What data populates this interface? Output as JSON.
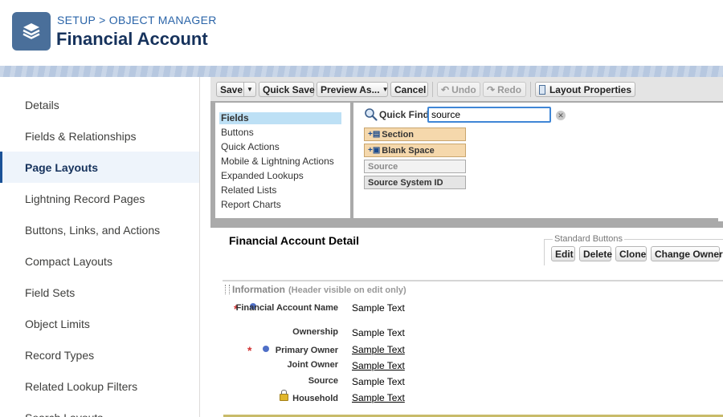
{
  "header": {
    "breadcrumb": "SETUP > OBJECT MANAGER",
    "title": "Financial Account",
    "icon": "layers-icon"
  },
  "nav": {
    "items": [
      {
        "label": "Details"
      },
      {
        "label": "Fields & Relationships"
      },
      {
        "label": "Page Layouts",
        "active": true
      },
      {
        "label": "Lightning Record Pages"
      },
      {
        "label": "Buttons, Links, and Actions"
      },
      {
        "label": "Compact Layouts"
      },
      {
        "label": "Field Sets"
      },
      {
        "label": "Object Limits"
      },
      {
        "label": "Record Types"
      },
      {
        "label": "Related Lookup Filters"
      },
      {
        "label": "Search Layouts"
      }
    ]
  },
  "toolbar": {
    "save": "Save",
    "quick_save": "Quick Save",
    "preview_as": "Preview As...",
    "cancel": "Cancel",
    "undo": "Undo",
    "redo": "Redo",
    "layout_properties": "Layout Properties"
  },
  "palette": {
    "categories": [
      {
        "label": "Fields",
        "active": true
      },
      {
        "label": "Buttons"
      },
      {
        "label": "Quick Actions"
      },
      {
        "label": "Mobile & Lightning Actions"
      },
      {
        "label": "Expanded Lookups"
      },
      {
        "label": "Related Lists"
      },
      {
        "label": "Report Charts"
      }
    ],
    "quick_find_label": "Quick Find",
    "quick_find_value": "source",
    "tiles": [
      {
        "label": "Section",
        "kind": "ui"
      },
      {
        "label": "Blank Space",
        "kind": "ui"
      },
      {
        "label": "Source",
        "kind": "used"
      },
      {
        "label": "Source System ID",
        "kind": "field"
      }
    ]
  },
  "detail": {
    "title": "Financial Account Detail",
    "standard_buttons_legend": "Standard Buttons",
    "buttons": [
      "Edit",
      "Delete",
      "Clone",
      "Change Owner"
    ],
    "section_title": "Information",
    "section_note": "(Header visible on edit only)",
    "fields": [
      {
        "label": "Financial Account Name",
        "value": "Sample Text",
        "required": true,
        "dot": true,
        "link": false
      },
      {
        "label": "Ownership",
        "value": "Sample Text",
        "required": false,
        "dot": false,
        "link": false
      },
      {
        "label": "Primary Owner",
        "value": "Sample Text",
        "required": true,
        "dot": true,
        "link": true
      },
      {
        "label": "Joint Owner",
        "value": "Sample Text",
        "required": false,
        "dot": false,
        "link": true
      },
      {
        "label": "Source",
        "value": "Sample Text",
        "required": false,
        "dot": false,
        "link": false
      },
      {
        "label": "Household",
        "value": "Sample Text",
        "required": false,
        "dot": false,
        "link": true,
        "locked": true
      }
    ]
  },
  "colors": {
    "brand": "#4a6f9a",
    "title": "#16325c",
    "link": "#2a64a8",
    "active_nav_bg": "#eef4fb",
    "required": "#d23232"
  }
}
